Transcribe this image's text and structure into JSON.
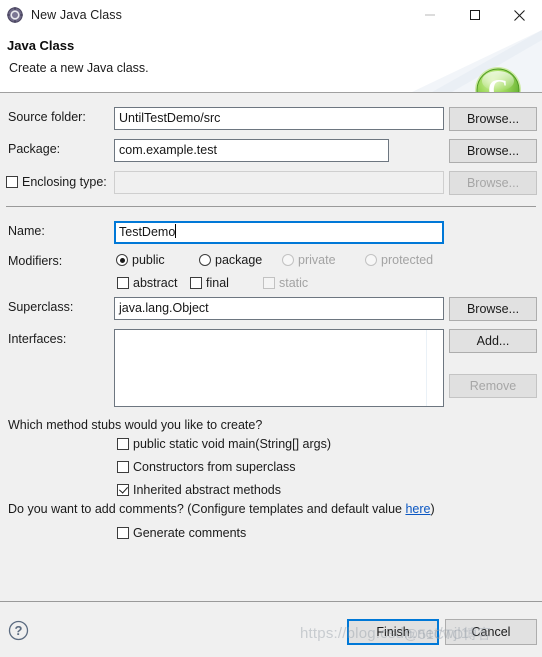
{
  "window": {
    "title": "New Java Class",
    "icon": "eclipse-gear-icon",
    "minimize_label": "",
    "maximize_label": "",
    "close_label": ""
  },
  "header": {
    "title": "Java Class",
    "subtitle": "Create a new Java class.",
    "badge_letter": "C",
    "badge_color": "#6cc24a"
  },
  "form": {
    "source_folder": {
      "label": "Source folder:",
      "value": "UntilTestDemo/src",
      "button": "Browse..."
    },
    "package": {
      "label": "Package:",
      "value": "com.example.test",
      "button": "Browse..."
    },
    "enclosing_type": {
      "label": "Enclosing type:",
      "value": "",
      "checked": false,
      "button": "Browse...",
      "enabled": false
    },
    "name": {
      "label": "Name:",
      "value": "TestDemo",
      "focused": true
    },
    "modifiers": {
      "label": "Modifiers:",
      "radios": [
        {
          "label": "public",
          "selected": true,
          "enabled": true
        },
        {
          "label": "package",
          "selected": false,
          "enabled": true
        },
        {
          "label": "private",
          "selected": false,
          "enabled": false
        },
        {
          "label": "protected",
          "selected": false,
          "enabled": false
        }
      ],
      "checkboxes": [
        {
          "label": "abstract",
          "checked": false,
          "enabled": true
        },
        {
          "label": "final",
          "checked": false,
          "enabled": true
        },
        {
          "label": "static",
          "checked": false,
          "enabled": false
        }
      ]
    },
    "superclass": {
      "label": "Superclass:",
      "value": "java.lang.Object",
      "button": "Browse..."
    },
    "interfaces": {
      "label": "Interfaces:",
      "items": [],
      "add_button": "Add...",
      "remove_button": "Remove",
      "remove_enabled": false
    }
  },
  "stubs": {
    "question": "Which method stubs would you like to create?",
    "options": [
      {
        "label": "public static void main(String[] args)",
        "checked": false
      },
      {
        "label": "Constructors from superclass",
        "checked": false
      },
      {
        "label": "Inherited abstract methods",
        "checked": true
      }
    ]
  },
  "comments": {
    "question_prefix": "Do you want to add comments? (Configure templates and default value ",
    "link": "here",
    "question_suffix": ")",
    "checkbox": {
      "label": "Generate comments",
      "checked": false
    }
  },
  "footer": {
    "help_icon": "help-question-icon",
    "finish": "Finish",
    "cancel": "Cancel",
    "watermark": "https://blog.csdn.net/wjl1",
    "watermark2": "@51CTO博客"
  }
}
